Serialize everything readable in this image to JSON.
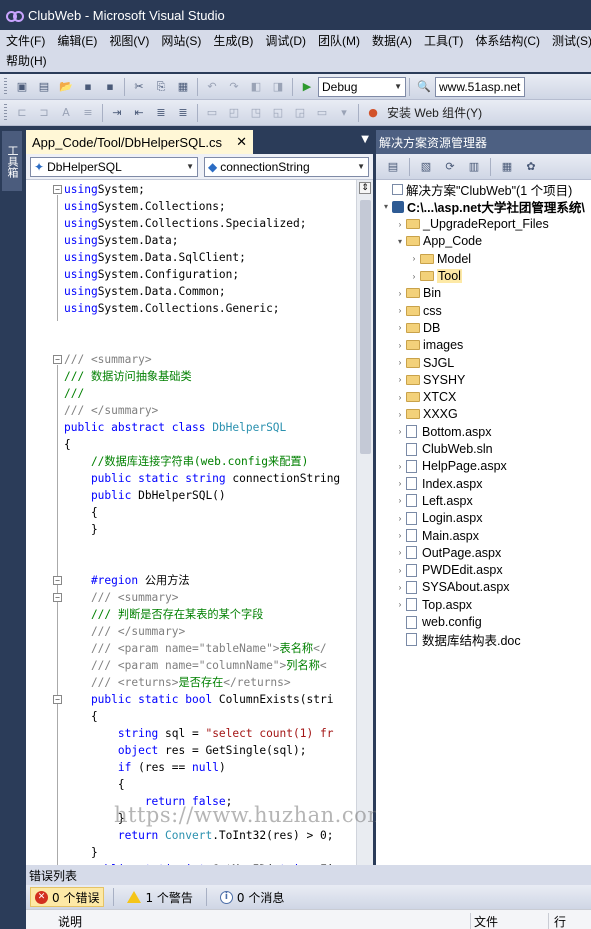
{
  "window": {
    "title": "ClubWeb - Microsoft Visual Studio"
  },
  "menu": {
    "items": [
      "文件(F)",
      "编辑(E)",
      "视图(V)",
      "网站(S)",
      "生成(B)",
      "调试(D)",
      "团队(M)",
      "数据(A)",
      "工具(T)",
      "体系结构(C)",
      "测试(S)"
    ],
    "help": "帮助(H)"
  },
  "toolbar": {
    "config": "Debug",
    "search": "www.51asp.net",
    "install_web_components": "安装 Web 组件(Y)"
  },
  "toolbox": {
    "label": "工具箱"
  },
  "editor": {
    "tab_title": "App_Code/Tool/DbHelperSQL.cs",
    "class_combo": "DbHelperSQL",
    "member_combo": "connectionString",
    "lines": [
      [
        [
          "kw",
          "using"
        ],
        [
          "",
          "System;"
        ]
      ],
      [
        [
          "kw",
          "using"
        ],
        [
          "",
          "System.Collections;"
        ]
      ],
      [
        [
          "kw",
          "using"
        ],
        [
          "",
          "System.Collections.Specialized;"
        ]
      ],
      [
        [
          "kw",
          "using"
        ],
        [
          "",
          "System.Data;"
        ]
      ],
      [
        [
          "kw",
          "using"
        ],
        [
          "",
          "System.Data.SqlClient;"
        ]
      ],
      [
        [
          "kw",
          "using"
        ],
        [
          "",
          "System.Configuration;"
        ]
      ],
      [
        [
          "kw",
          "using"
        ],
        [
          "",
          "System.Data.Common;"
        ]
      ],
      [
        [
          "kw",
          "using"
        ],
        [
          "",
          "System.Collections.Generic;"
        ]
      ],
      [],
      [],
      [
        [
          "xdoc",
          "/// <summary>"
        ]
      ],
      [
        [
          "cm",
          "/// 数据访问抽象基础类"
        ]
      ],
      [
        [
          "cm",
          "///"
        ]
      ],
      [
        [
          "xdoc",
          "/// </summary>"
        ]
      ],
      [
        [
          "kw",
          "public abstract class"
        ],
        [
          "ty",
          " DbHelperSQL"
        ]
      ],
      [
        [
          "",
          "{"
        ]
      ],
      [
        [
          "cm",
          "    //数据库连接字符串(web.config来配置)"
        ]
      ],
      [
        [
          "kw",
          "    public static string"
        ],
        [
          "",
          " connectionString"
        ]
      ],
      [
        [
          "kw",
          "    public"
        ],
        [
          "",
          " DbHelperSQL()"
        ]
      ],
      [
        [
          "",
          "    {"
        ]
      ],
      [
        [
          "",
          "    }"
        ]
      ],
      [],
      [],
      [
        [
          "kw",
          "    #region"
        ],
        [
          "",
          " 公用方法"
        ]
      ],
      [
        [
          "xdoc",
          "    /// <summary>"
        ]
      ],
      [
        [
          "cm",
          "    /// 判断是否存在某表的某个字段"
        ]
      ],
      [
        [
          "xdoc",
          "    /// </summary>"
        ]
      ],
      [
        [
          "xdoc",
          "    /// <param name=\"tableName\">"
        ],
        [
          "cm",
          "表名称"
        ],
        [
          "xdoc",
          "</"
        ]
      ],
      [
        [
          "xdoc",
          "    /// <param name=\"columnName\">"
        ],
        [
          "cm",
          "列名称"
        ],
        [
          "xdoc",
          "<"
        ]
      ],
      [
        [
          "xdoc",
          "    /// <returns>"
        ],
        [
          "cm",
          "是否存在"
        ],
        [
          "xdoc",
          "</returns>"
        ]
      ],
      [
        [
          "kw",
          "    public static bool"
        ],
        [
          "",
          " ColumnExists(stri"
        ]
      ],
      [
        [
          "",
          "    {"
        ]
      ],
      [
        [
          "kw",
          "        string"
        ],
        [
          "",
          " sql = "
        ],
        [
          "st",
          "\"select count(1) fr"
        ]
      ],
      [
        [
          "kw",
          "        object"
        ],
        [
          "",
          " res = GetSingle(sql);"
        ]
      ],
      [
        [
          "kw",
          "        if"
        ],
        [
          "",
          " (res == "
        ],
        [
          "kw",
          "null"
        ],
        [
          "",
          ")"
        ]
      ],
      [
        [
          "",
          "        {"
        ]
      ],
      [
        [
          "kw",
          "            return false"
        ],
        [
          "",
          ";"
        ]
      ],
      [
        [
          "",
          "        }"
        ]
      ],
      [
        [
          "kw",
          "        return"
        ],
        [
          "ty",
          " Convert"
        ],
        [
          "",
          ".ToInt32(res) > 0;"
        ]
      ],
      [
        [
          "",
          "    }"
        ]
      ],
      [
        [
          "kw",
          "    public static int"
        ],
        [
          "",
          " GetMaxID("
        ],
        [
          "kw",
          "string"
        ],
        [
          "",
          " Fi"
        ]
      ],
      [
        [
          "",
          "    {"
        ]
      ]
    ]
  },
  "watermark": "https://www.huzhan.com/ishop3572",
  "solution_explorer": {
    "title": "解决方案资源管理器",
    "nodes": [
      {
        "label": "解决方案\"ClubWeb\"(1 个项目)",
        "icon": "sln",
        "indent": 0,
        "exp": ""
      },
      {
        "label": "C:\\...\\asp.net大学社团管理系统\\",
        "icon": "proj",
        "indent": 0,
        "exp": "▾",
        "bold": true
      },
      {
        "label": "_UpgradeReport_Files",
        "icon": "folder",
        "indent": 1,
        "exp": "›"
      },
      {
        "label": "App_Code",
        "icon": "folder",
        "indent": 1,
        "exp": "▾"
      },
      {
        "label": "Model",
        "icon": "folder",
        "indent": 2,
        "exp": "›"
      },
      {
        "label": "Tool",
        "icon": "folder",
        "indent": 2,
        "exp": "›",
        "selected": true
      },
      {
        "label": "Bin",
        "icon": "folder",
        "indent": 1,
        "exp": "›"
      },
      {
        "label": "css",
        "icon": "folder",
        "indent": 1,
        "exp": "›"
      },
      {
        "label": "DB",
        "icon": "folder",
        "indent": 1,
        "exp": "›"
      },
      {
        "label": "images",
        "icon": "folder",
        "indent": 1,
        "exp": "›"
      },
      {
        "label": "SJGL",
        "icon": "folder",
        "indent": 1,
        "exp": "›"
      },
      {
        "label": "SYSHY",
        "icon": "folder",
        "indent": 1,
        "exp": "›"
      },
      {
        "label": "XTCX",
        "icon": "folder",
        "indent": 1,
        "exp": "›"
      },
      {
        "label": "XXXG",
        "icon": "folder",
        "indent": 1,
        "exp": "›"
      },
      {
        "label": "Bottom.aspx",
        "icon": "file",
        "indent": 1,
        "exp": "›"
      },
      {
        "label": "ClubWeb.sln",
        "icon": "file",
        "indent": 1,
        "exp": ""
      },
      {
        "label": "HelpPage.aspx",
        "icon": "file",
        "indent": 1,
        "exp": "›"
      },
      {
        "label": "Index.aspx",
        "icon": "file",
        "indent": 1,
        "exp": "›"
      },
      {
        "label": "Left.aspx",
        "icon": "file",
        "indent": 1,
        "exp": "›"
      },
      {
        "label": "Login.aspx",
        "icon": "file",
        "indent": 1,
        "exp": "›"
      },
      {
        "label": "Main.aspx",
        "icon": "file",
        "indent": 1,
        "exp": "›"
      },
      {
        "label": "OutPage.aspx",
        "icon": "file",
        "indent": 1,
        "exp": "›"
      },
      {
        "label": "PWDEdit.aspx",
        "icon": "file",
        "indent": 1,
        "exp": "›"
      },
      {
        "label": "SYSAbout.aspx",
        "icon": "file",
        "indent": 1,
        "exp": "›"
      },
      {
        "label": "Top.aspx",
        "icon": "file",
        "indent": 1,
        "exp": "›"
      },
      {
        "label": "web.config",
        "icon": "file",
        "indent": 1,
        "exp": ""
      },
      {
        "label": "数据库结构表.doc",
        "icon": "file",
        "indent": 1,
        "exp": ""
      }
    ]
  },
  "error_list": {
    "title": "错误列表",
    "errors": "0 个错误",
    "warnings": "1 个警告",
    "messages": "0 个消息",
    "col_description": "说明",
    "col_file": "文件",
    "col_line": "行"
  }
}
